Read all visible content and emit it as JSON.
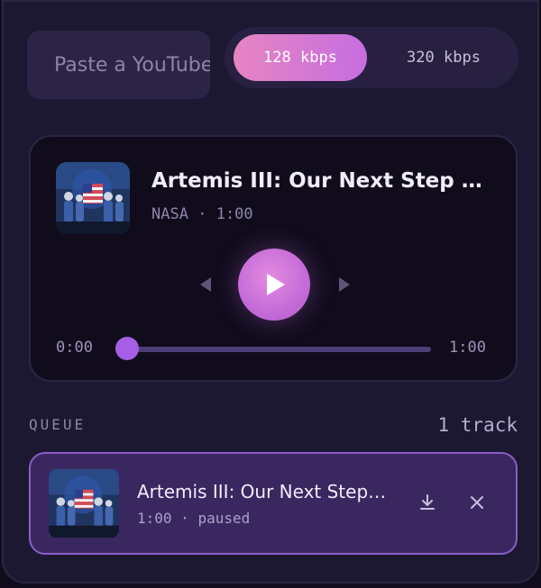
{
  "input": {
    "placeholder": "Paste a YouTube link"
  },
  "bitrate": {
    "options": [
      "128 kbps",
      "320 kbps"
    ],
    "selected": "128 kbps"
  },
  "now_playing": {
    "title": "Artemis III: Our Next Step Back to the Moon",
    "channel": "NASA",
    "separator": "·",
    "duration": "1:00",
    "elapsed": "0:00",
    "progress": 0
  },
  "queue": {
    "heading": "QUEUE",
    "count_label": "1 track",
    "items": [
      {
        "title": "Artemis III: Our Next Step Back to the Moon",
        "duration": "1:00",
        "separator": "·",
        "status": "paused"
      }
    ]
  },
  "icons": {
    "previous": "skip-previous-icon",
    "play": "play-icon",
    "next": "skip-next-icon",
    "download": "download-icon",
    "remove": "close-icon"
  },
  "colors": {
    "accent": "#c76ee0",
    "active_pill_start": "#e684c2",
    "seek_thumb": "#a65ee6",
    "queue_item_bg": "#3b2760",
    "queue_item_border": "#8a5fc8"
  }
}
